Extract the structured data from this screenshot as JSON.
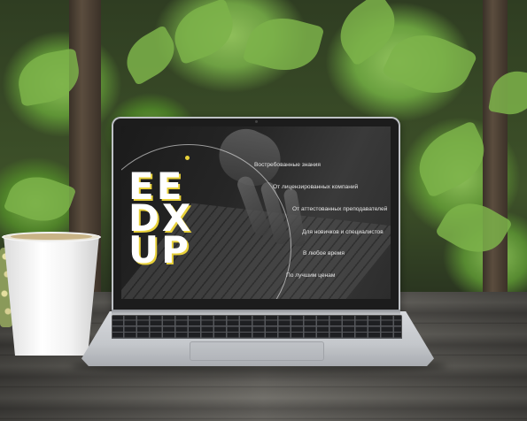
{
  "screen": {
    "logo_lines": [
      "EE",
      "DX",
      "UP"
    ],
    "features": [
      "Востребованные знания",
      "От лицензированных компаний",
      "От аттестованных преподавателей",
      "Для новичков и специалистов",
      "В любое время",
      "По лучшим ценам"
    ],
    "accent_color": "#e8d13a"
  }
}
